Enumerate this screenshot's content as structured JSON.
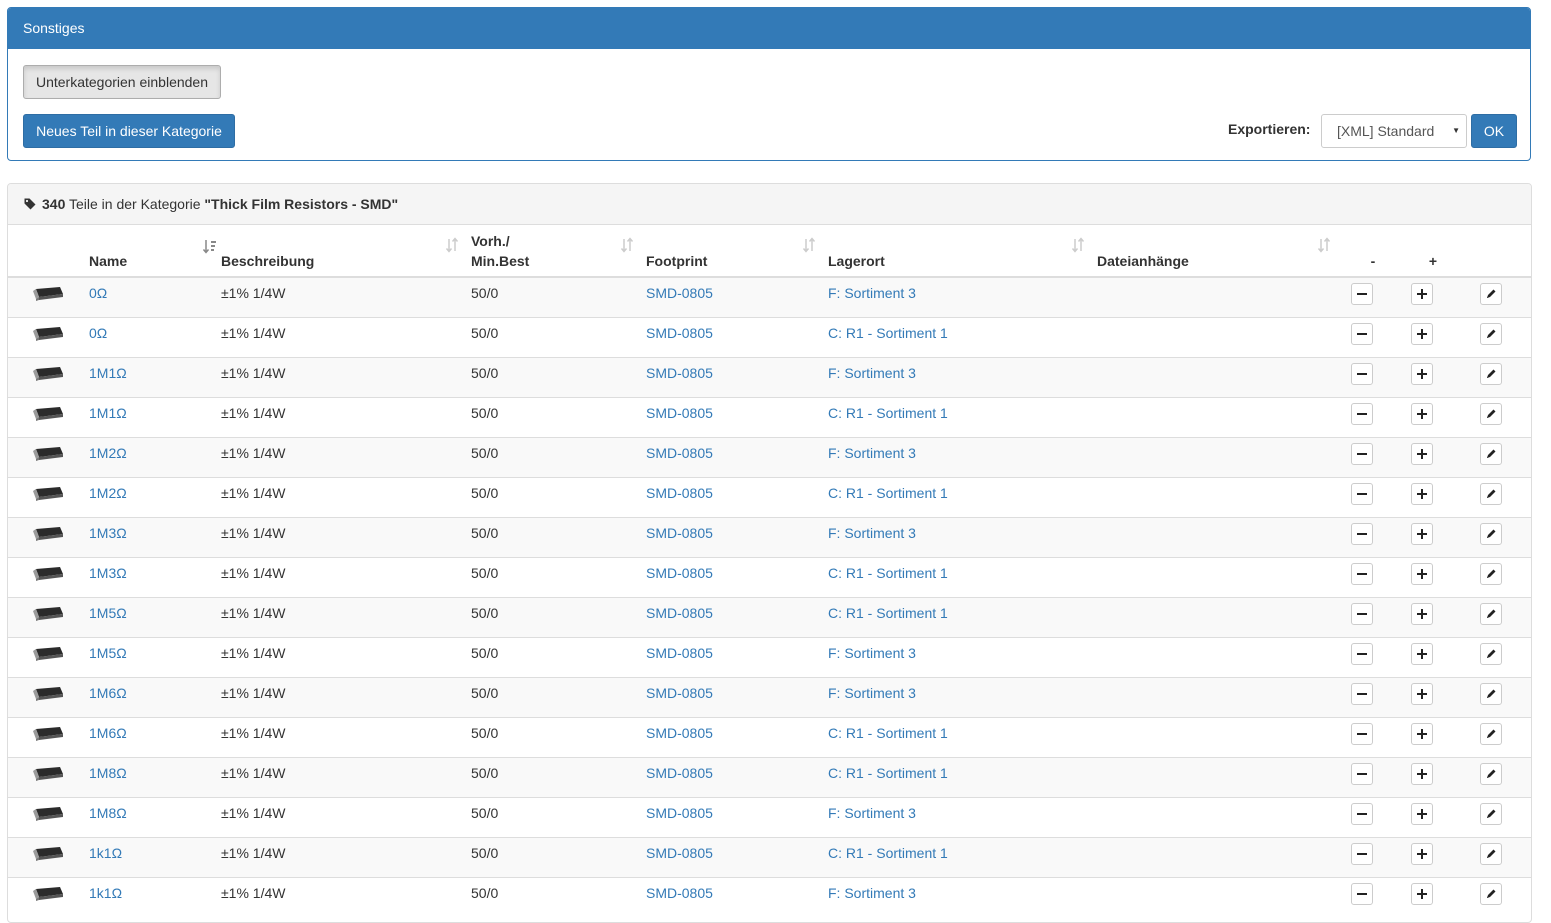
{
  "top_panel": {
    "title": "Sonstiges",
    "subcats_button": "Unterkategorien einblenden",
    "new_part_button": "Neues Teil in dieser Kategorie",
    "export_label": "Exportieren:",
    "export_selected": "[XML] Standard",
    "ok_button": "OK"
  },
  "parts_panel": {
    "count": "340",
    "text_middle": " Teile in der Kategorie ",
    "category": "\"Thick Film Resistors - SMD\"",
    "tag_icon": "tag-icon"
  },
  "table": {
    "headers": {
      "name": "Name",
      "description": "Beschreibung",
      "stock_line1": "Vorh./",
      "stock_line2": "Min.Best",
      "footprint": "Footprint",
      "location": "Lagerort",
      "attachments": "Dateianhänge",
      "minus": "-",
      "plus": "+"
    },
    "rows": [
      {
        "name": "0Ω",
        "description": "±1% 1/4W",
        "stock": "50/0",
        "footprint": "SMD-0805",
        "location": "F: Sortiment 3"
      },
      {
        "name": "0Ω",
        "description": "±1% 1/4W",
        "stock": "50/0",
        "footprint": "SMD-0805",
        "location": "C: R1 - Sortiment 1"
      },
      {
        "name": "1M1Ω",
        "description": "±1% 1/4W",
        "stock": "50/0",
        "footprint": "SMD-0805",
        "location": "F: Sortiment 3"
      },
      {
        "name": "1M1Ω",
        "description": "±1% 1/4W",
        "stock": "50/0",
        "footprint": "SMD-0805",
        "location": "C: R1 - Sortiment 1"
      },
      {
        "name": "1M2Ω",
        "description": "±1% 1/4W",
        "stock": "50/0",
        "footprint": "SMD-0805",
        "location": "F: Sortiment 3"
      },
      {
        "name": "1M2Ω",
        "description": "±1% 1/4W",
        "stock": "50/0",
        "footprint": "SMD-0805",
        "location": "C: R1 - Sortiment 1"
      },
      {
        "name": "1M3Ω",
        "description": "±1% 1/4W",
        "stock": "50/0",
        "footprint": "SMD-0805",
        "location": "F: Sortiment 3"
      },
      {
        "name": "1M3Ω",
        "description": "±1% 1/4W",
        "stock": "50/0",
        "footprint": "SMD-0805",
        "location": "C: R1 - Sortiment 1"
      },
      {
        "name": "1M5Ω",
        "description": "±1% 1/4W",
        "stock": "50/0",
        "footprint": "SMD-0805",
        "location": "C: R1 - Sortiment 1"
      },
      {
        "name": "1M5Ω",
        "description": "±1% 1/4W",
        "stock": "50/0",
        "footprint": "SMD-0805",
        "location": "F: Sortiment 3"
      },
      {
        "name": "1M6Ω",
        "description": "±1% 1/4W",
        "stock": "50/0",
        "footprint": "SMD-0805",
        "location": "F: Sortiment 3"
      },
      {
        "name": "1M6Ω",
        "description": "±1% 1/4W",
        "stock": "50/0",
        "footprint": "SMD-0805",
        "location": "C: R1 - Sortiment 1"
      },
      {
        "name": "1M8Ω",
        "description": "±1% 1/4W",
        "stock": "50/0",
        "footprint": "SMD-0805",
        "location": "C: R1 - Sortiment 1"
      },
      {
        "name": "1M8Ω",
        "description": "±1% 1/4W",
        "stock": "50/0",
        "footprint": "SMD-0805",
        "location": "F: Sortiment 3"
      },
      {
        "name": "1k1Ω",
        "description": "±1% 1/4W",
        "stock": "50/0",
        "footprint": "SMD-0805",
        "location": "C: R1 - Sortiment 1"
      },
      {
        "name": "1k1Ω",
        "description": "±1% 1/4W",
        "stock": "50/0",
        "footprint": "SMD-0805",
        "location": "F: Sortiment 3"
      }
    ]
  },
  "colors": {
    "primary": "#337ab7",
    "link": "#337ab7",
    "stripe": "#f9f9f9",
    "border": "#dddddd"
  },
  "icons": {
    "sort": "sort-icon",
    "sort_active": "sort-alpha-icon",
    "minus": "minus-icon",
    "plus": "plus-icon",
    "edit": "pencil-icon",
    "thumbnail": "smd-resistor-thumbnail",
    "select_caret": "caret-down-icon"
  }
}
